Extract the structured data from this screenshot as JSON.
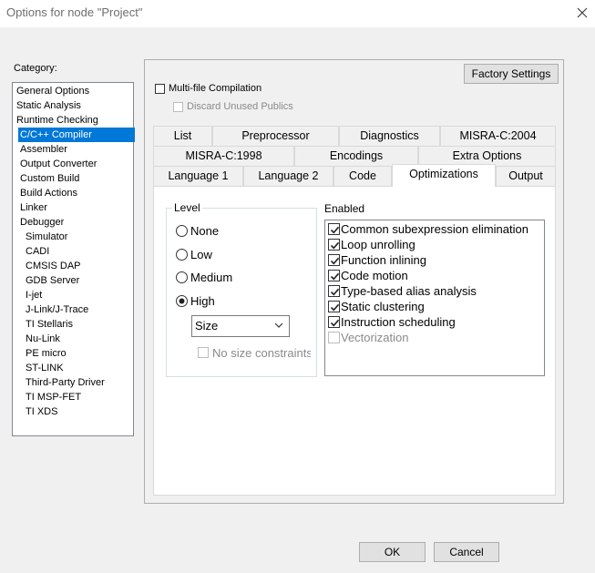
{
  "window": {
    "title": "Options for node \"Project\"",
    "close_icon": "close-icon"
  },
  "category": {
    "label": "Category:",
    "items": [
      {
        "label": "General Options",
        "level": 0,
        "selected": false
      },
      {
        "label": "Static Analysis",
        "level": 0,
        "selected": false
      },
      {
        "label": "Runtime Checking",
        "level": 0,
        "selected": false
      },
      {
        "label": "C/C++ Compiler",
        "level": 1,
        "selected": true
      },
      {
        "label": "Assembler",
        "level": 1,
        "selected": false
      },
      {
        "label": "Output Converter",
        "level": 1,
        "selected": false
      },
      {
        "label": "Custom Build",
        "level": 1,
        "selected": false
      },
      {
        "label": "Build Actions",
        "level": 1,
        "selected": false
      },
      {
        "label": "Linker",
        "level": 1,
        "selected": false
      },
      {
        "label": "Debugger",
        "level": 1,
        "selected": false
      },
      {
        "label": "Simulator",
        "level": 2,
        "selected": false
      },
      {
        "label": "CADI",
        "level": 2,
        "selected": false
      },
      {
        "label": "CMSIS DAP",
        "level": 2,
        "selected": false
      },
      {
        "label": "GDB Server",
        "level": 2,
        "selected": false
      },
      {
        "label": "I-jet",
        "level": 2,
        "selected": false
      },
      {
        "label": "J-Link/J-Trace",
        "level": 2,
        "selected": false
      },
      {
        "label": "TI Stellaris",
        "level": 2,
        "selected": false
      },
      {
        "label": "Nu-Link",
        "level": 2,
        "selected": false
      },
      {
        "label": "PE micro",
        "level": 2,
        "selected": false
      },
      {
        "label": "ST-LINK",
        "level": 2,
        "selected": false
      },
      {
        "label": "Third-Party Driver",
        "level": 2,
        "selected": false
      },
      {
        "label": "TI MSP-FET",
        "level": 2,
        "selected": false
      },
      {
        "label": "TI XDS",
        "level": 2,
        "selected": false
      }
    ]
  },
  "panel": {
    "factory_settings": "Factory Settings",
    "multifile": {
      "label": "Multi-file Compilation",
      "checked": false
    },
    "discard": {
      "label": "Discard Unused Publics",
      "checked": false,
      "enabled": false
    }
  },
  "tabs": {
    "row1": [
      "List",
      "Preprocessor",
      "Diagnostics",
      "MISRA-C:2004"
    ],
    "row2": [
      "MISRA-C:1998",
      "Encodings",
      "Extra Options"
    ],
    "row3": [
      "Language 1",
      "Language 2",
      "Code",
      "Optimizations",
      "Output"
    ],
    "active": "Optimizations"
  },
  "level": {
    "title": "Level",
    "options": [
      "None",
      "Low",
      "Medium",
      "High"
    ],
    "selected": "High",
    "size_select": "Size",
    "no_size_constraints": "No size constraints"
  },
  "enabled": {
    "title": "Enabled",
    "items": [
      {
        "label": "Common subexpression elimination",
        "checked": true,
        "enabled": true
      },
      {
        "label": "Loop unrolling",
        "checked": true,
        "enabled": true
      },
      {
        "label": "Function inlining",
        "checked": true,
        "enabled": true
      },
      {
        "label": "Code motion",
        "checked": true,
        "enabled": true
      },
      {
        "label": "Type-based alias analysis",
        "checked": true,
        "enabled": true
      },
      {
        "label": "Static clustering",
        "checked": true,
        "enabled": true
      },
      {
        "label": "Instruction scheduling",
        "checked": true,
        "enabled": true
      },
      {
        "label": "Vectorization",
        "checked": false,
        "enabled": false
      }
    ]
  },
  "footer": {
    "ok": "OK",
    "cancel": "Cancel"
  }
}
